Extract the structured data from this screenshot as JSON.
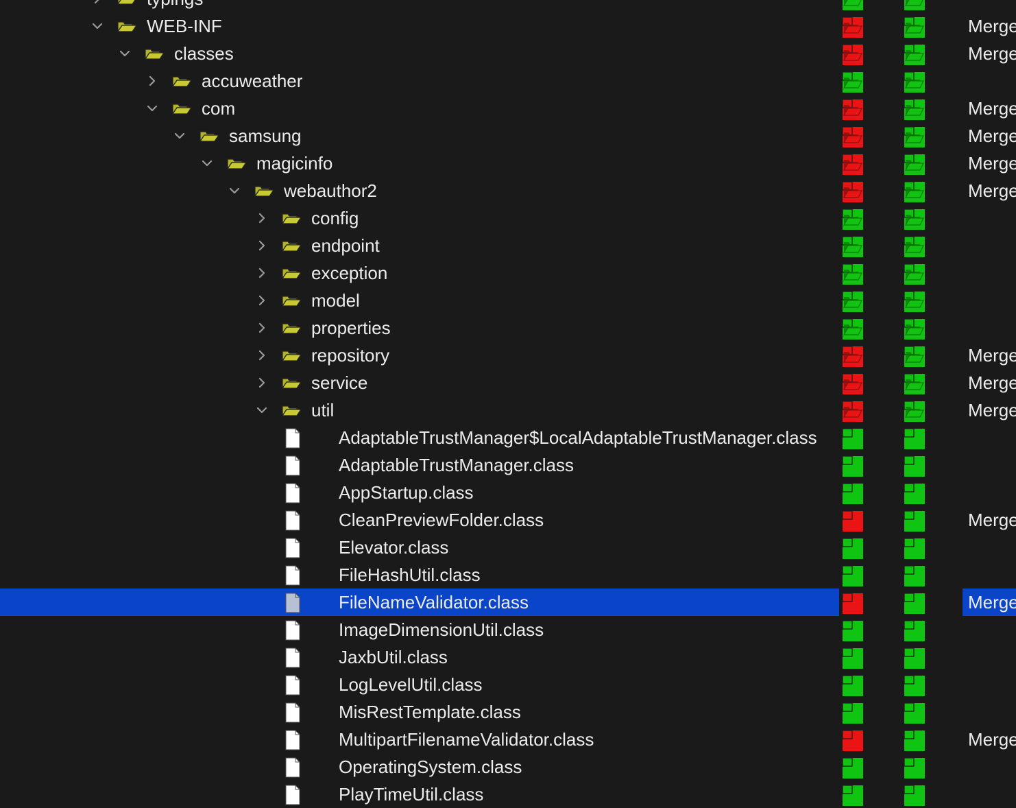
{
  "colors": {
    "background": "#1a1a1a",
    "selection": "#0a44c9",
    "status_differs": "#ea1414",
    "status_same": "#12c412",
    "folder": "#c8c832"
  },
  "rows": [
    {
      "label": "typings",
      "depth": 3,
      "kind": "folder",
      "expanded": false,
      "status_left": "same",
      "status_right": "same",
      "merge": "",
      "icon": "folder-icon"
    },
    {
      "label": "WEB-INF",
      "depth": 3,
      "kind": "folder",
      "expanded": true,
      "status_left": "differs",
      "status_right": "same",
      "merge": "Merge",
      "icon": "folder-icon"
    },
    {
      "label": "classes",
      "depth": 4,
      "kind": "folder",
      "expanded": true,
      "status_left": "differs",
      "status_right": "same",
      "merge": "Merge",
      "icon": "folder-icon"
    },
    {
      "label": "accuweather",
      "depth": 5,
      "kind": "folder",
      "expanded": false,
      "status_left": "same",
      "status_right": "same",
      "merge": "",
      "icon": "folder-icon"
    },
    {
      "label": "com",
      "depth": 5,
      "kind": "folder",
      "expanded": true,
      "status_left": "differs",
      "status_right": "same",
      "merge": "Merge",
      "icon": "folder-icon"
    },
    {
      "label": "samsung",
      "depth": 6,
      "kind": "folder",
      "expanded": true,
      "status_left": "differs",
      "status_right": "same",
      "merge": "Merge",
      "icon": "folder-icon"
    },
    {
      "label": "magicinfo",
      "depth": 7,
      "kind": "folder",
      "expanded": true,
      "status_left": "differs",
      "status_right": "same",
      "merge": "Merge",
      "icon": "folder-icon"
    },
    {
      "label": "webauthor2",
      "depth": 8,
      "kind": "folder",
      "expanded": true,
      "status_left": "differs",
      "status_right": "same",
      "merge": "Merge",
      "icon": "folder-icon"
    },
    {
      "label": "config",
      "depth": 9,
      "kind": "folder",
      "expanded": false,
      "status_left": "same",
      "status_right": "same",
      "merge": "",
      "icon": "folder-icon"
    },
    {
      "label": "endpoint",
      "depth": 9,
      "kind": "folder",
      "expanded": false,
      "status_left": "same",
      "status_right": "same",
      "merge": "",
      "icon": "folder-icon"
    },
    {
      "label": "exception",
      "depth": 9,
      "kind": "folder",
      "expanded": false,
      "status_left": "same",
      "status_right": "same",
      "merge": "",
      "icon": "folder-icon"
    },
    {
      "label": "model",
      "depth": 9,
      "kind": "folder",
      "expanded": false,
      "status_left": "same",
      "status_right": "same",
      "merge": "",
      "icon": "folder-icon"
    },
    {
      "label": "properties",
      "depth": 9,
      "kind": "folder",
      "expanded": false,
      "status_left": "same",
      "status_right": "same",
      "merge": "",
      "icon": "folder-icon"
    },
    {
      "label": "repository",
      "depth": 9,
      "kind": "folder",
      "expanded": false,
      "status_left": "differs",
      "status_right": "same",
      "merge": "Merge",
      "icon": "folder-icon"
    },
    {
      "label": "service",
      "depth": 9,
      "kind": "folder",
      "expanded": false,
      "status_left": "differs",
      "status_right": "same",
      "merge": "Merge",
      "icon": "folder-icon"
    },
    {
      "label": "util",
      "depth": 9,
      "kind": "folder",
      "expanded": true,
      "status_left": "differs",
      "status_right": "same",
      "merge": "Merge",
      "icon": "folder-icon"
    },
    {
      "label": "AdaptableTrustManager$LocalAdaptableTrustManager.class",
      "depth": 10,
      "kind": "file",
      "status_left": "same",
      "status_right": "same",
      "merge": "",
      "icon": "file-icon"
    },
    {
      "label": "AdaptableTrustManager.class",
      "depth": 10,
      "kind": "file",
      "status_left": "same",
      "status_right": "same",
      "merge": "",
      "icon": "file-icon"
    },
    {
      "label": "AppStartup.class",
      "depth": 10,
      "kind": "file",
      "status_left": "same",
      "status_right": "same",
      "merge": "",
      "icon": "file-icon"
    },
    {
      "label": "CleanPreviewFolder.class",
      "depth": 10,
      "kind": "file",
      "status_left": "differs",
      "status_right": "same",
      "merge": "Merge",
      "icon": "file-icon"
    },
    {
      "label": "Elevator.class",
      "depth": 10,
      "kind": "file",
      "status_left": "same",
      "status_right": "same",
      "merge": "",
      "icon": "file-icon"
    },
    {
      "label": "FileHashUtil.class",
      "depth": 10,
      "kind": "file",
      "status_left": "same",
      "status_right": "same",
      "merge": "",
      "icon": "file-icon"
    },
    {
      "label": "FileNameValidator.class",
      "depth": 10,
      "kind": "file",
      "status_left": "differs",
      "status_right": "same",
      "merge": "Merge",
      "selected": true,
      "icon": "file-icon"
    },
    {
      "label": "ImageDimensionUtil.class",
      "depth": 10,
      "kind": "file",
      "status_left": "same",
      "status_right": "same",
      "merge": "",
      "icon": "file-icon"
    },
    {
      "label": "JaxbUtil.class",
      "depth": 10,
      "kind": "file",
      "status_left": "same",
      "status_right": "same",
      "merge": "",
      "icon": "file-icon"
    },
    {
      "label": "LogLevelUtil.class",
      "depth": 10,
      "kind": "file",
      "status_left": "same",
      "status_right": "same",
      "merge": "",
      "icon": "file-icon"
    },
    {
      "label": "MisRestTemplate.class",
      "depth": 10,
      "kind": "file",
      "status_left": "same",
      "status_right": "same",
      "merge": "",
      "icon": "file-icon"
    },
    {
      "label": "MultipartFilenameValidator.class",
      "depth": 10,
      "kind": "file",
      "status_left": "differs",
      "status_right": "same",
      "merge": "Merge",
      "icon": "file-icon"
    },
    {
      "label": "OperatingSystem.class",
      "depth": 10,
      "kind": "file",
      "status_left": "same",
      "status_right": "same",
      "merge": "",
      "icon": "file-icon"
    },
    {
      "label": "PlayTimeUtil.class",
      "depth": 10,
      "kind": "file",
      "status_left": "same",
      "status_right": "same",
      "merge": "",
      "icon": "file-icon"
    }
  ]
}
